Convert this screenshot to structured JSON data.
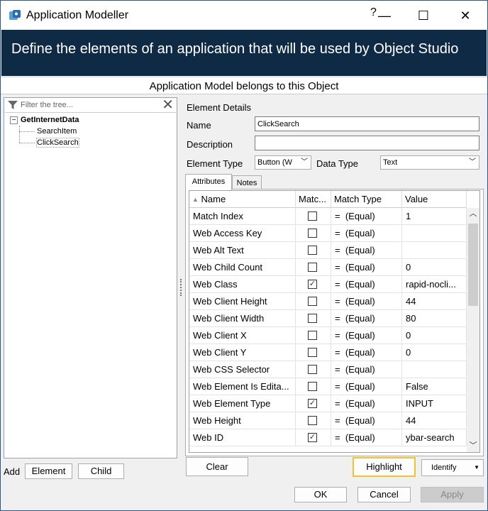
{
  "window": {
    "title": "Application Modeller",
    "help": "?",
    "minimize": "—",
    "maximize": "☐",
    "close": "✕"
  },
  "banner": "Define the elements of an application that will be used by Object Studio",
  "belongs_label": "Application Model belongs to this Object",
  "tree": {
    "filter_placeholder": "Filter the tree...",
    "root": "GetInternetData",
    "expander": "−",
    "children": [
      "SearchItem",
      "ClickSearch"
    ]
  },
  "add": {
    "label": "Add",
    "element_button": "Element",
    "child_button": "Child"
  },
  "details": {
    "heading": "Element Details",
    "name_label": "Name",
    "name_value": "ClickSearch",
    "description_label": "Description",
    "description_value": "",
    "element_type_label": "Element Type",
    "element_type_value": "Button (W",
    "data_type_label": "Data Type",
    "data_type_value": "Text"
  },
  "tabs": [
    "Attributes",
    "Notes"
  ],
  "grid": {
    "columns": [
      "Name",
      "Matc...",
      "Match Type",
      "Value"
    ],
    "rows": [
      {
        "name": "Match Index",
        "checked": false,
        "eq": "=",
        "match": "(Equal)",
        "value": "1"
      },
      {
        "name": "Web Access Key",
        "checked": false,
        "eq": "=",
        "match": "(Equal)",
        "value": ""
      },
      {
        "name": "Web Alt Text",
        "checked": false,
        "eq": "=",
        "match": "(Equal)",
        "value": ""
      },
      {
        "name": "Web Child Count",
        "checked": false,
        "eq": "=",
        "match": "(Equal)",
        "value": "0"
      },
      {
        "name": "Web Class",
        "checked": true,
        "eq": "=",
        "match": "(Equal)",
        "value": "rapid-nocli..."
      },
      {
        "name": "Web Client Height",
        "checked": false,
        "eq": "=",
        "match": "(Equal)",
        "value": "44"
      },
      {
        "name": "Web Client Width",
        "checked": false,
        "eq": "=",
        "match": "(Equal)",
        "value": "80"
      },
      {
        "name": "Web Client X",
        "checked": false,
        "eq": "=",
        "match": "(Equal)",
        "value": "0"
      },
      {
        "name": "Web Client Y",
        "checked": false,
        "eq": "=",
        "match": "(Equal)",
        "value": "0"
      },
      {
        "name": "Web CSS Selector",
        "checked": false,
        "eq": "=",
        "match": "(Equal)",
        "value": ""
      },
      {
        "name": "Web Element Is Edita...",
        "checked": false,
        "eq": "=",
        "match": "(Equal)",
        "value": "False"
      },
      {
        "name": "Web Element Type",
        "checked": true,
        "eq": "=",
        "match": "(Equal)",
        "value": "INPUT"
      },
      {
        "name": "Web Height",
        "checked": false,
        "eq": "=",
        "match": "(Equal)",
        "value": "44"
      },
      {
        "name": "Web ID",
        "checked": true,
        "eq": "=",
        "match": "(Equal)",
        "value": "ybar-search"
      }
    ]
  },
  "buttons": {
    "clear": "Clear",
    "highlight": "Highlight",
    "identify": "Identify",
    "ok": "OK",
    "cancel": "Cancel",
    "apply": "Apply"
  },
  "colors": {
    "banner_bg": "#0f2a45",
    "highlight_border": "#f2c12e",
    "selection": "#cce8ff"
  },
  "icons": [
    "app-icon",
    "filter-icon",
    "clear-filter-icon",
    "sort-asc-icon",
    "checkbox-checked-icon",
    "chevron-down-icon",
    "scroll-up-icon",
    "scroll-down-icon"
  ]
}
